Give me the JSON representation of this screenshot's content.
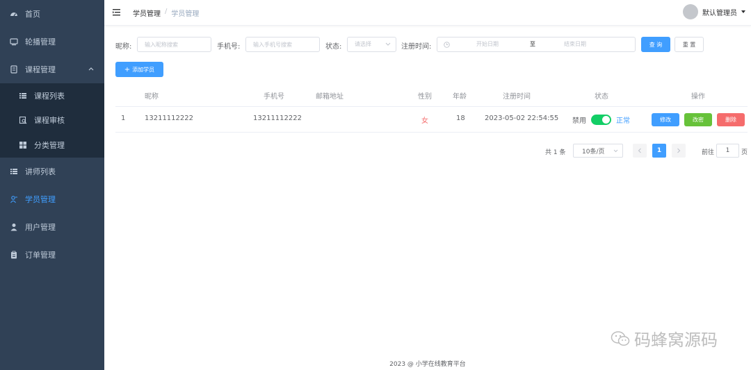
{
  "sidebar": {
    "items": [
      {
        "label": "首页",
        "icon": "dashboard-icon"
      },
      {
        "label": "轮播管理",
        "icon": "carousel-icon"
      },
      {
        "label": "课程管理",
        "icon": "course-icon"
      },
      {
        "label": "讲师列表",
        "icon": "list-icon"
      },
      {
        "label": "学员管理",
        "icon": "student-icon"
      },
      {
        "label": "用户管理",
        "icon": "user-icon"
      },
      {
        "label": "订单管理",
        "icon": "clipboard-icon"
      }
    ],
    "subitems": [
      {
        "label": "课程列表",
        "icon": "list-icon"
      },
      {
        "label": "课程审核",
        "icon": "audit-icon"
      },
      {
        "label": "分类管理",
        "icon": "grid-icon"
      }
    ]
  },
  "header": {
    "breadcrumb": [
      "学员管理",
      "学员管理"
    ],
    "separator": "/",
    "username": "默认管理员"
  },
  "search": {
    "nickname_label": "昵称:",
    "nickname_placeholder": "输入昵称搜索",
    "phone_label": "手机号:",
    "phone_placeholder": "输入手机号搜索",
    "status_label": "状态:",
    "status_placeholder": "请选择",
    "regtime_label": "注册时间:",
    "start_placeholder": "开始日期",
    "range_sep": "至",
    "end_placeholder": "结束日期",
    "query_label": "查 询",
    "reset_label": "重 置",
    "add_label": "添加学员",
    "add_prefix": "+"
  },
  "table": {
    "columns": [
      "昵称",
      "手机号",
      "邮箱地址",
      "性别",
      "年龄",
      "注册时间",
      "状态",
      "操作"
    ],
    "rows": [
      {
        "index": "1",
        "nickname": "13211112222",
        "phone": "13211112222",
        "email": "",
        "gender": "女",
        "age": "18",
        "regtime": "2023-05-02 22:54:55",
        "status_off": "禁用",
        "status_on": "正常",
        "status_enabled": true,
        "edit_label": "修改",
        "change_label": "改密",
        "delete_label": "删除"
      }
    ]
  },
  "pagination": {
    "total": "共 1 条",
    "page_size": "10条/页",
    "current_page": "1",
    "goto_label": "前往",
    "goto_value": "1",
    "page_unit": "页"
  },
  "footer": "2023 @ 小学在线教育平台",
  "watermark": "码蜂窝源码",
  "colors": {
    "sidebar_bg": "#304156",
    "submenu_bg": "#1f2d3d",
    "primary": "#409eff",
    "success": "#67c23a",
    "danger": "#f56c6c",
    "switch_on": "#13ce66",
    "gender_female": "#f56c6c"
  }
}
